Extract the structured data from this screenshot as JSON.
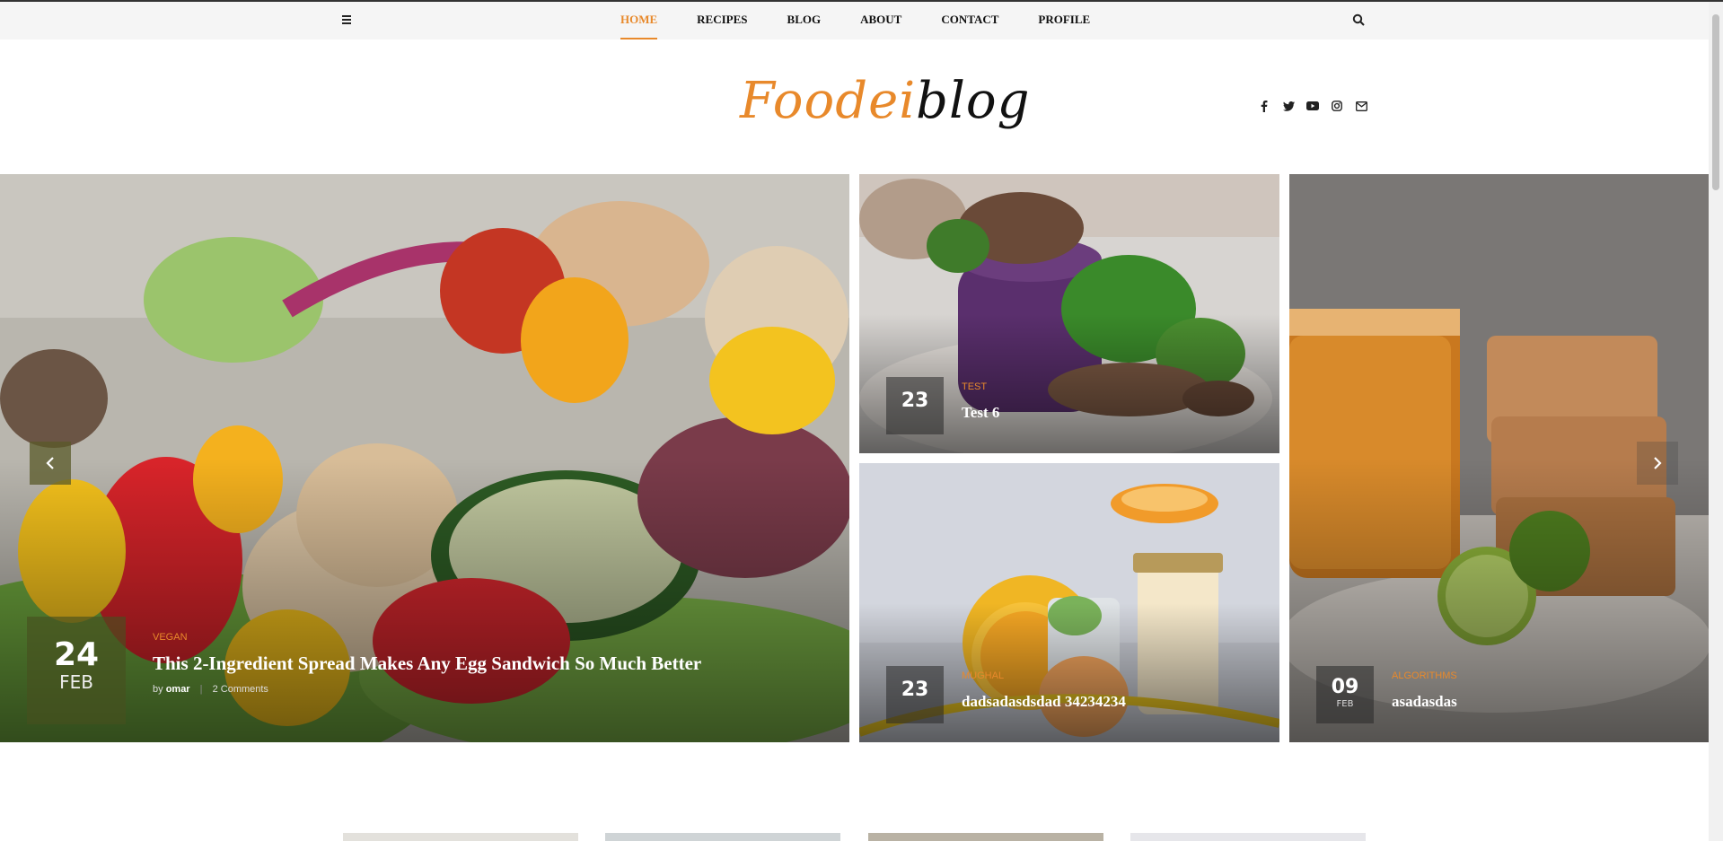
{
  "nav": {
    "menu_icon": "hamburger-icon",
    "links": [
      {
        "label": "HOME",
        "active": true
      },
      {
        "label": "RECIPES",
        "active": false
      },
      {
        "label": "BLOG",
        "active": false
      },
      {
        "label": "ABOUT",
        "active": false
      },
      {
        "label": "CONTACT",
        "active": false
      },
      {
        "label": "PROFILE",
        "active": false
      }
    ],
    "search_icon": "search-icon"
  },
  "logo": {
    "part1": "Foodei",
    "part2": "blog"
  },
  "socials": [
    "facebook-icon",
    "twitter-icon",
    "youtube-icon",
    "instagram-icon",
    "mail-icon"
  ],
  "featured": {
    "day": "24",
    "month": "FEB",
    "category": "VEGAN",
    "title": "This 2-Ingredient Spread Makes Any Egg Sandwich So Much Better",
    "author_prefix": "by",
    "author": "omar",
    "comments": "2 Comments"
  },
  "posts": [
    {
      "day": "23",
      "month": "",
      "category": "TEST",
      "title": "Test 6"
    },
    {
      "day": "23",
      "month": "",
      "category": "MUGHAL",
      "title": "dadsadasdsdad 34234234"
    },
    {
      "day": "09",
      "month": "FEB",
      "category": "ALGORITHMS",
      "title": "asadasdas"
    }
  ],
  "colors": {
    "accent": "#e8892b",
    "nav_bg": "#f5f5f5"
  }
}
